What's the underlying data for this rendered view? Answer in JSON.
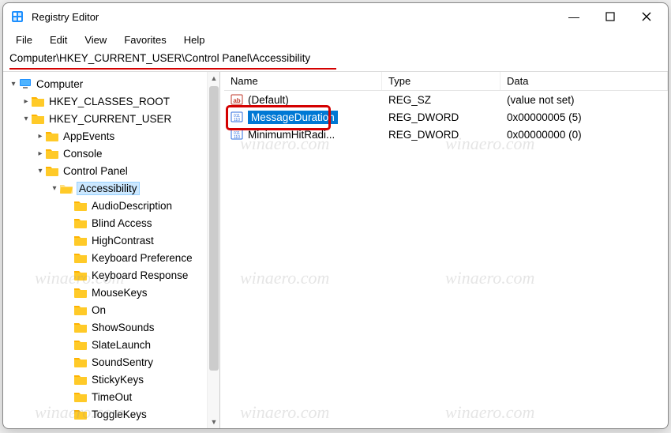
{
  "window": {
    "title": "Registry Editor"
  },
  "window_buttons": {
    "minimize": "—",
    "maximize": "▢",
    "close": "✕"
  },
  "menubar": {
    "file": "File",
    "edit": "Edit",
    "view": "View",
    "favorites": "Favorites",
    "help": "Help"
  },
  "address": "Computer\\HKEY_CURRENT_USER\\Control Panel\\Accessibility",
  "tree": {
    "root": "Computer",
    "hives": {
      "hkcr": "HKEY_CLASSES_ROOT",
      "hkcu": "HKEY_CURRENT_USER"
    },
    "hkcu_children": {
      "appevents": "AppEvents",
      "console": "Console",
      "controlpanel": "Control Panel"
    },
    "accessibility": "Accessibility",
    "accessibility_children": [
      "AudioDescription",
      "Blind Access",
      "HighContrast",
      "Keyboard Preference",
      "Keyboard Response",
      "MouseKeys",
      "On",
      "ShowSounds",
      "SlateLaunch",
      "SoundSentry",
      "StickyKeys",
      "TimeOut",
      "ToggleKeys"
    ]
  },
  "list": {
    "headers": {
      "name": "Name",
      "type": "Type",
      "data": "Data"
    },
    "rows": [
      {
        "name": "(Default)",
        "icon": "sz",
        "type": "REG_SZ",
        "data": "(value not set)"
      },
      {
        "name": "MessageDuration",
        "icon": "dword",
        "type": "REG_DWORD",
        "data": "0x00000005 (5)"
      },
      {
        "name": "MinimumHitRadi...",
        "icon": "dword",
        "type": "REG_DWORD",
        "data": "0x00000000 (0)"
      }
    ]
  },
  "watermark_text": "winaero.com"
}
